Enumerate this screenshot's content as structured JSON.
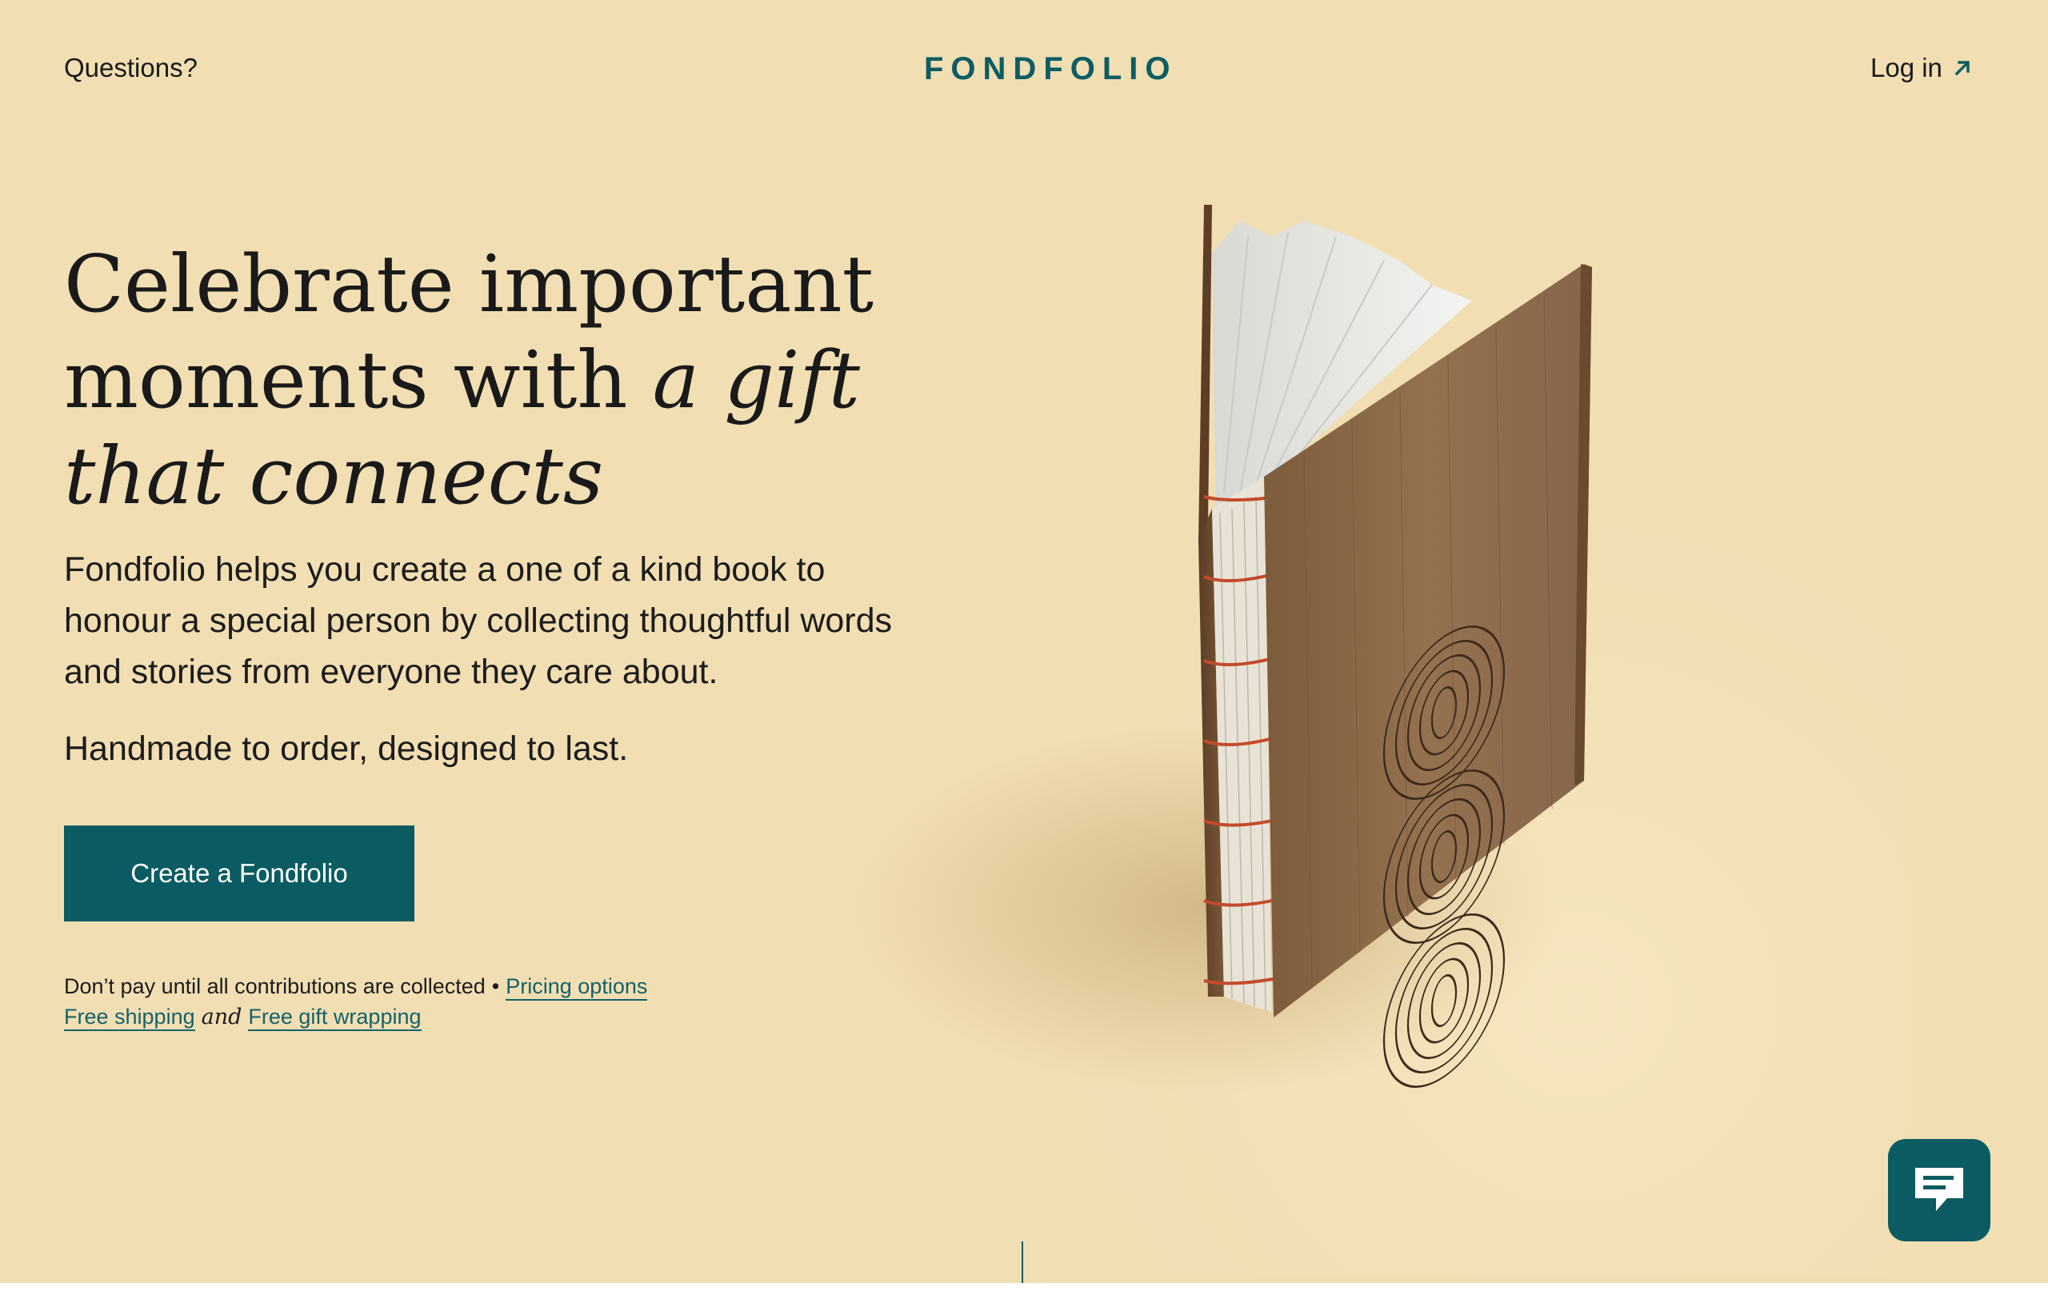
{
  "header": {
    "questions_label": "Questions?",
    "logo_text": "FONDFOLIO",
    "login_label": "Log in"
  },
  "hero": {
    "headline_line1": "Celebrate important",
    "headline_line2_plain": "moments with ",
    "headline_line2_italic": "a gift",
    "headline_line3_italic": "that connects",
    "description": "Fondfolio helps you create a one of a kind book to honour a special person by collecting thoughtful words and stories from everyone they care about.",
    "tagline": "Handmade to order, designed to last.",
    "cta_label": "Create a Fondfolio",
    "note_text": "Don’t pay until all contributions are collected",
    "note_bullet": "•",
    "pricing_link": "Pricing options",
    "shipping_link": "Free shipping",
    "and_word": "and",
    "wrapping_link": "Free gift wrapping"
  },
  "icons": {
    "login_arrow": "arrow-up-right-icon",
    "chat": "chat-bubble-icon"
  },
  "colors": {
    "background": "#f1deb2",
    "brand_teal": "#0b5c62",
    "text": "#1c1c1c"
  }
}
